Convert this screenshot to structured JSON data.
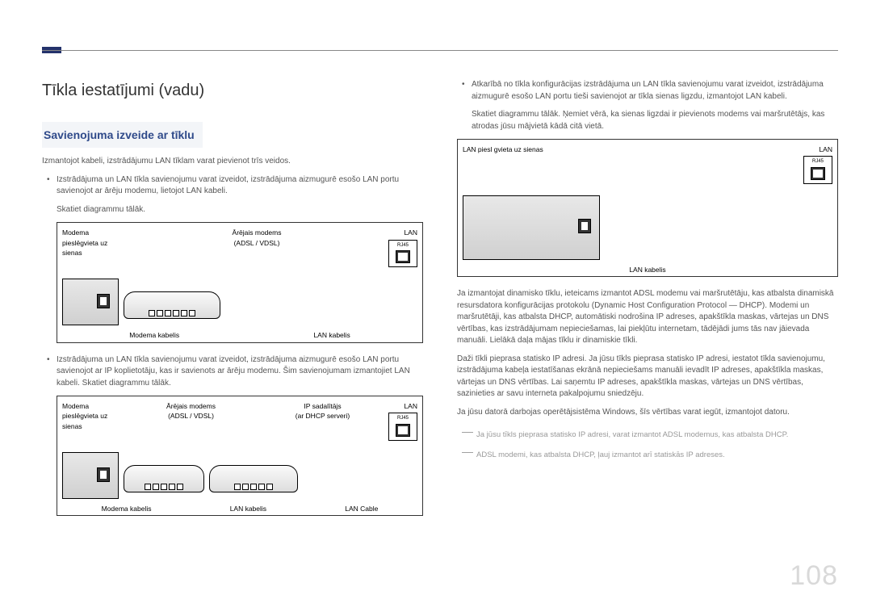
{
  "heading": "Tīkla iestatījumi (vadu)",
  "subheading": "Savienojuma izveide ar tīklu",
  "intro": "Izmantojot kabeli, izstrādājumu LAN tīklam varat pievienot trīs veidos.",
  "col1": {
    "bullet1": "Izstrādājuma un LAN tīkla savienojumu varat izveidot, izstrādājuma aizmugurē esošo LAN portu savienojot ar ārēju modemu, lietojot LAN kabeli.",
    "sub1": "Skatiet diagrammu tālāk.",
    "bullet2": "Izstrādājuma un LAN tīkla savienojumu varat izveidot, izstrādājuma aizmugurē esošo LAN portu savienojot ar IP koplietotāju, kas ir savienots ar ārēju modemu. Šim savienojumam izmantojiet LAN kabeli. Skatiet diagrammu tālāk."
  },
  "diagrams": {
    "d1": {
      "wall_label": "Modema pieslēgvieta uz sienas",
      "modem_label": "Ārējais modems",
      "modem_sub": "(ADSL / VDSL)",
      "lan_top": "LAN",
      "rj45": "RJ45",
      "cable1": "Modema kabelis",
      "cable2": "LAN kabelis"
    },
    "d2": {
      "wall_label": "Modema pieslēgvieta uz sienas",
      "modem_label": "Ārējais modems",
      "modem_sub": "(ADSL / VDSL)",
      "router_label": "IP sadalītājs",
      "router_sub": "(ar DHCP serveri)",
      "lan_top": "LAN",
      "rj45": "RJ45",
      "cable1": "Modema kabelis",
      "cable2": "LAN kabelis",
      "cable3": "LAN Cable"
    },
    "d3": {
      "wall_label": "LAN piesl gvieta uz sienas",
      "lan_top": "LAN",
      "rj45": "RJ45",
      "cable1": "LAN kabelis"
    }
  },
  "col2": {
    "bullet3": "Atkarībā no tīkla konfigurācijas izstrādājuma un LAN tīkla savienojumu varat izveidot, izstrādājuma aizmugurē esošo LAN portu tieši savienojot ar tīkla sienas ligzdu, izmantojot LAN kabeli.",
    "sub3": "Skatiet diagrammu tālāk. Ņemiet vērā, ka sienas ligzdai ir pievienots modems vai maršrutētājs, kas atrodas jūsu mājvietā kādā citā vietā.",
    "para1": "Ja izmantojat dinamisko tīklu, ieteicams izmantot ADSL modemu vai maršrutētāju, kas atbalsta dinamiskā resursdatora konfigurācijas protokolu (Dynamic Host Configuration Protocol — DHCP). Modemi un maršrutētāji, kas atbalsta DHCP, automātiski nodrošina IP adreses, apakštīkla maskas, vārtejas un DNS vērtības, kas izstrādājumam nepieciešamas, lai piekļūtu internetam, tādējādi jums tās nav jāievada manuāli. Lielākā daļa mājas tīklu ir dinamiskie tīkli.",
    "para2": "Daži tīkli pieprasa statisko IP adresi. Ja jūsu tīkls pieprasa statisko IP adresi, iestatot tīkla savienojumu, izstrādājuma kabeļa iestatīšanas ekrānā nepieciešams manuāli ievadīt IP adreses, apakštīkla maskas, vārtejas un DNS vērtības. Lai saņemtu IP adreses, apakštīkla maskas, vārtejas un DNS vērtības, sazinieties ar savu interneta pakalpojumu sniedzēju.",
    "para3": "Ja jūsu datorā darbojas operētājsistēma Windows, šīs vērtības varat iegūt, izmantojot datoru.",
    "note1": "Ja jūsu tīkls pieprasa statisko IP adresi, varat izmantot ADSL modemus, kas atbalsta DHCP.",
    "note2": "ADSL modemi, kas atbalsta DHCP, ļauj izmantot arī statiskās IP adreses."
  },
  "page_number": "108"
}
